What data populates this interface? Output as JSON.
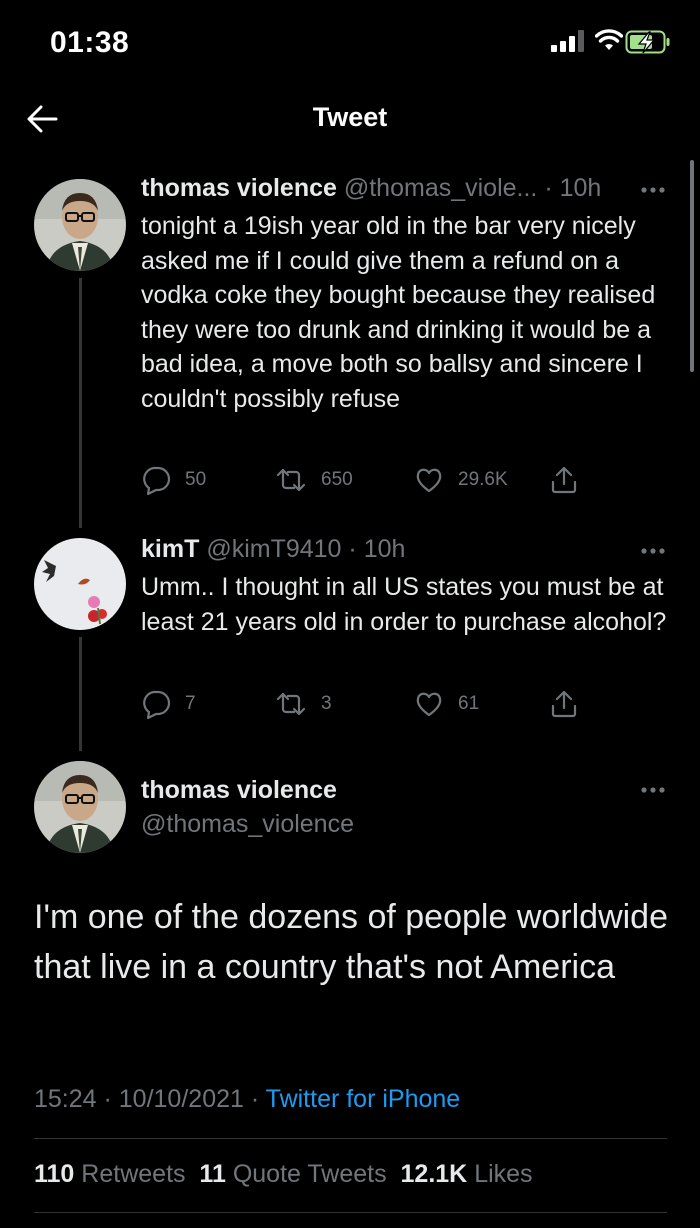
{
  "status_bar": {
    "time": "01:38"
  },
  "header": {
    "title": "Tweet"
  },
  "tweet1": {
    "name": "thomas violence",
    "handle": "@thomas_viole...",
    "time": "· 10h",
    "text": "tonight a 19ish year old in the bar very nicely asked me if I could give them a refund on a vodka coke they bought because they realised they were too drunk and drinking it would be a bad idea, a move both so ballsy and sincere I couldn't possibly refuse",
    "replies": "50",
    "retweets": "650",
    "likes": "29.6K"
  },
  "tweet2": {
    "name": "kimT",
    "handle": "@kimT9410",
    "time": "· 10h",
    "text": "Umm.. I thought in all US states you must be at least 21 years old in order to purchase alcohol?",
    "replies": "7",
    "retweets": "3",
    "likes": "61"
  },
  "main_tweet": {
    "name": "thomas violence",
    "handle": "@thomas_violence",
    "text": "I'm one of the dozens of people worldwide that live in a country that's not America",
    "timestamp": "15:24 · 10/10/2021 ·",
    "source": "Twitter for iPhone",
    "retweets_count": "110",
    "retweets_label": "Retweets",
    "quotes_count": "11",
    "quotes_label": "Quote Tweets",
    "likes_count": "12.1K",
    "likes_label": "Likes"
  },
  "colors": {
    "background": "#000000",
    "accent": "#1d9bf0",
    "muted": "#71767b",
    "text": "#e7e9ea"
  },
  "icons": [
    "back-arrow-icon",
    "more-icon",
    "reply-icon",
    "retweet-icon",
    "like-icon",
    "share-icon"
  ]
}
